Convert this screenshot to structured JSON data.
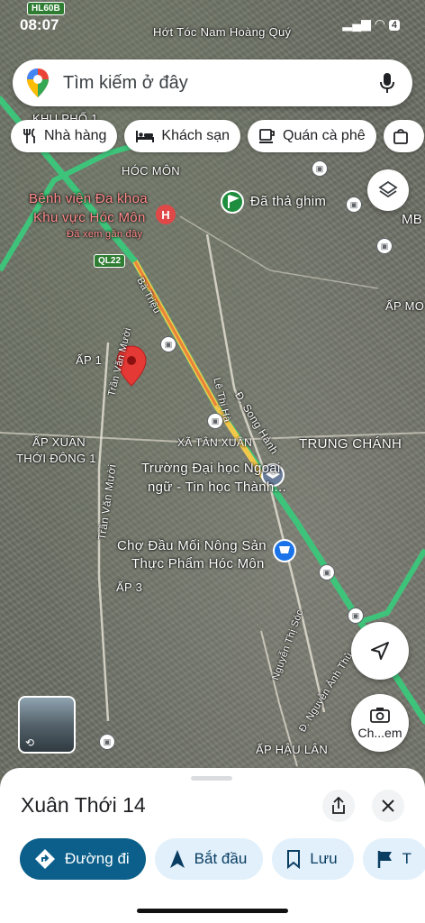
{
  "status": {
    "time": "08:07",
    "top_place": "HL60B",
    "battery": "4"
  },
  "search": {
    "placeholder": "Tìm kiếm ở đây"
  },
  "chips": [
    {
      "label": "Nhà hàng",
      "icon": "fork-knife-icon"
    },
    {
      "label": "Khách sạn",
      "icon": "bed-icon"
    },
    {
      "label": "Quán cà phê",
      "icon": "coffee-icon"
    }
  ],
  "map_labels": {
    "salon": "Hớt Tóc Nam Hoàng Quý",
    "hoc_mon": "HÓC MÔN",
    "khu_pho": "KHU PHỐ 1",
    "hospital_1": "Bệnh viện Đa khoa",
    "hospital_2": "Khu vực Hóc Môn",
    "hospital_sub": "Đã xem gần đây",
    "pinned": "Đã thả ghim",
    "mb": "MB",
    "ap_mo": "ẤP MO",
    "ql22": "QL22",
    "ba_trieu": "Bà Triệu",
    "tran_van_muoi_1": "Trần Văn Mười",
    "ap1": "ẤP 1",
    "le_thi_ha": "Lê Thị Hà",
    "song_hanh": "Đ. Song Hành",
    "xa_tan_xuan": "XÃ TÂN XUÂN",
    "trung_chanh": "TRUNG CHÁNH",
    "ap_xuan": "ẤP XUÂN",
    "thoi_dong": "THỚI ĐÔNG 1",
    "school_1": "Trường Đại học Ngoại",
    "school_2": "ngữ - Tin học Thành...",
    "tran_van_muoi_2": "Trần Văn Mười",
    "market_1": "Chợ Đầu Mối Nông Sản",
    "market_2": "Thực Phẩm Hóc Môn",
    "ap3": "ẤP 3",
    "nguyen_thi_soc": "Nguyễn Thị Sóc",
    "nguyen_anh_thu": "Đ. Nguyễn Ảnh Thủ",
    "ap_hau_lan": "ẤP HẬU LÂN"
  },
  "buttons": {
    "streetview_label": "Ch...em"
  },
  "sheet": {
    "title": "Xuân Thới 14",
    "actions": [
      {
        "label": "Đường đi"
      },
      {
        "label": "Bắt đầu"
      },
      {
        "label": "Lưu"
      },
      {
        "label": "T"
      }
    ]
  },
  "colors": {
    "route_green": "#3ec47a",
    "highway_yellow": "#f2c84b",
    "pin_red": "#e53935",
    "primary_button": "#0b5f8a"
  }
}
